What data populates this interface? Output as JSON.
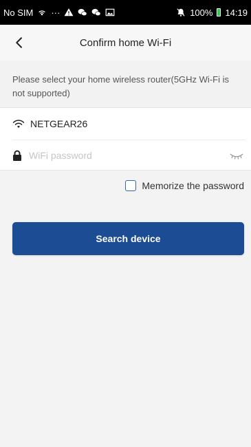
{
  "status_bar": {
    "carrier": "No SIM",
    "dots": "···",
    "battery": "100%",
    "time": "14:19"
  },
  "header": {
    "title": "Confirm home Wi-Fi"
  },
  "instruction": {
    "text": "Please select your home wireless router(5GHz Wi-Fi is not supported)"
  },
  "wifi": {
    "ssid": "NETGEAR26",
    "password_placeholder": "WiFi password",
    "password_value": ""
  },
  "memorize": {
    "label": "Memorize the password",
    "checked": false
  },
  "search_button": {
    "label": "Search device"
  },
  "colors": {
    "primary": "#1b4c94",
    "checkbox_border": "#2f65b8",
    "background": "#f3f3f3",
    "battery": "#32c850"
  },
  "icons": {
    "back": "chevron-left-icon",
    "wifi": "wifi-icon",
    "lock": "lock-icon",
    "eye": "eye-closed-icon"
  }
}
